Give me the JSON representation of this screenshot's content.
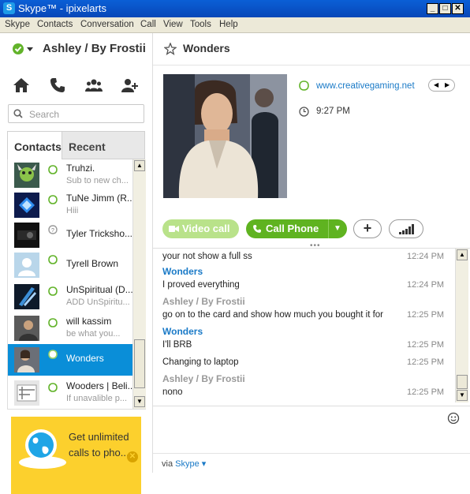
{
  "window": {
    "title": "Skype™ - ipixelarts",
    "logo_letter": "S",
    "buttons": {
      "minimize": "_",
      "maximize": "□",
      "close": "✕"
    }
  },
  "menu": [
    "Skype",
    "Contacts",
    "Conversation",
    "Call",
    "View",
    "Tools",
    "Help"
  ],
  "profile": {
    "name": "Ashley / By Frostii"
  },
  "nav_icons": [
    "home-icon",
    "phone-icon",
    "contacts-group-icon",
    "add-contact-icon"
  ],
  "search": {
    "placeholder": "Search"
  },
  "tabs": {
    "contacts": "Contacts",
    "recent": "Recent"
  },
  "contacts": [
    {
      "name": "Truhzi.",
      "mood": "Sub to new ch...",
      "status": "online"
    },
    {
      "name": "TuNe Jimm (R...",
      "mood": "Hiii",
      "status": "online"
    },
    {
      "name": "Tyler Tricksho...",
      "mood": "",
      "status": "unknown"
    },
    {
      "name": "Tyrell Brown",
      "mood": "",
      "status": "online"
    },
    {
      "name": "UnSpiritual (D...",
      "mood": "ADD UnSpiritu...",
      "status": "online"
    },
    {
      "name": "will kassim",
      "mood": "be what you...",
      "status": "online"
    },
    {
      "name": "Wonders",
      "mood": "",
      "status": "online",
      "selected": true
    },
    {
      "name": "Wooders | Beli...",
      "mood": "If unavalible p...",
      "status": "online"
    }
  ],
  "ad": {
    "text": "Get unlimited calls to pho..."
  },
  "conversation": {
    "title": "Wonders",
    "website": "www.creativegaming.net",
    "local_time": "9:27 PM",
    "buttons": {
      "video": "Video call",
      "call": "Call Phone"
    },
    "messages": [
      {
        "sender": "",
        "text": "your not show a full ss",
        "time": "12:24 PM"
      },
      {
        "sender": "Wonders",
        "who": "them",
        "text": "I proved everything",
        "time": "12:24 PM"
      },
      {
        "sender": "Ashley / By Frostii",
        "who": "me",
        "text": "go on to the card and show how much you bought it for",
        "time": "12:25 PM"
      },
      {
        "sender": "Wonders",
        "who": "them",
        "text": "I'll BRB",
        "time": "12:25 PM"
      },
      {
        "sender": "",
        "text": "Changing to laptop",
        "time": "12:25 PM"
      },
      {
        "sender": "Ashley / By Frostii",
        "who": "me",
        "text": "nono",
        "time": "12:25 PM"
      }
    ],
    "via_label": "via",
    "via_service": "Skype"
  },
  "colors": {
    "accent": "#0a8ed8",
    "call_green": "#5fb320",
    "video_green": "#b9e28a",
    "ad_yellow": "#fcd02d",
    "link_blue": "#1a7ac7"
  }
}
